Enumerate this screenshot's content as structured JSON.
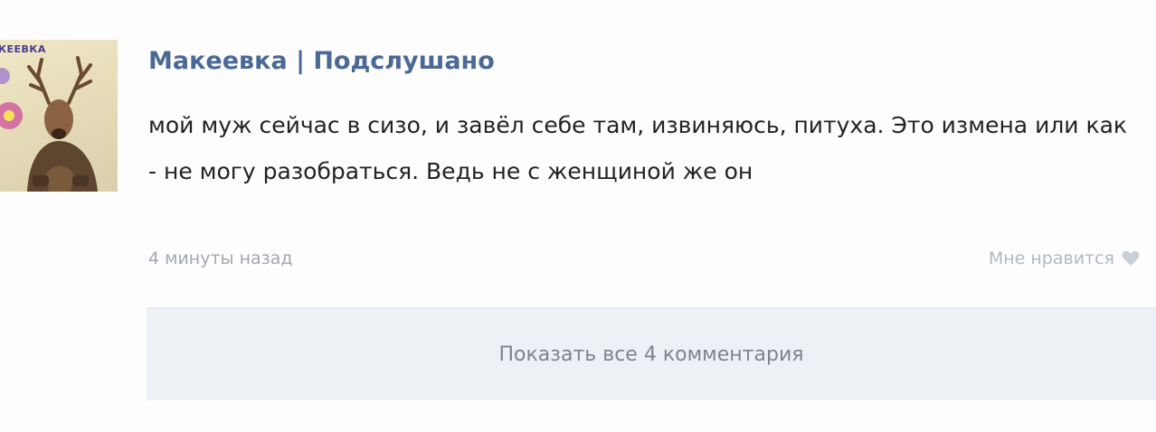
{
  "post": {
    "avatar": {
      "caption": "КЕЕВКА",
      "icon": "deer-avatar-image"
    },
    "author": "Макеевка | Подслушано",
    "text": "мой муж сейчас в сизо, и завёл себе там, извиняюсь, питуха. Это измена или как - не могу разобраться. Ведь не с женщиной же он",
    "timestamp": "4 минуты назад",
    "like_label": "Мне нравится",
    "like_icon": "heart-icon",
    "show_comments_label": "Показать все 4 комментария"
  },
  "colors": {
    "author_link": "#4a6996",
    "meta_text": "#a3a8ae",
    "comments_bar": "#edf0f4"
  }
}
